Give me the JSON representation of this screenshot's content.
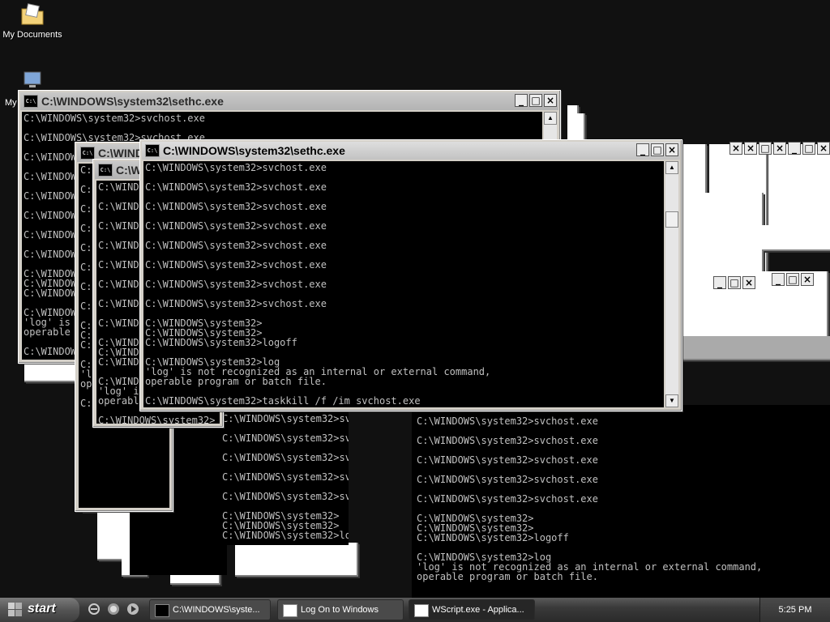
{
  "desktop": {
    "icons": [
      {
        "label": "My Documents",
        "icon": "folder-documents-icon"
      },
      {
        "label": "My",
        "icon": "my-computer-icon"
      }
    ]
  },
  "windows": {
    "back": {
      "title": "C:\\WINDOWS\\system32\\sethc.exe",
      "lines": [
        "C:\\WINDOWS\\system32>svchost.exe",
        "",
        "C:\\WINDOWS\\system32>svchost.exe",
        "",
        "C:\\WINDOWS\\system32>svchost.exe",
        "",
        "C:\\WINDOWS\\system32>svchost.exe",
        "",
        "C:\\WINDOWS\\system32>svchost.exe",
        "",
        "C:\\WINDOWS\\system32>svchost.exe",
        "",
        "C:\\WINDOWS\\system32>svchost.exe",
        "",
        "C:\\WINDOWS\\system32>svchost.exe",
        "",
        "C:\\WINDOWS\\system32>",
        "C:\\WINDOWS\\system32>",
        "C:\\WINDOWS\\system32>logoff",
        "",
        "C:\\WINDOWS\\system32>log",
        "'log' is not recognized as an internal or external command,",
        "operable program or batch file.",
        "",
        "C:\\WINDOWS\\system32>"
      ]
    },
    "middle": {
      "title": "C:\\WINDOWS\\system32\\sethc.exe",
      "lines": [
        "C:\\WINDOWS\\system32>svchost.exe",
        "",
        "C:\\WINDOWS\\system32>svchost.exe",
        "",
        "C:\\WINDOWS\\system32>svchost.exe",
        "",
        "C:\\WINDOWS\\system32>svchost.exe",
        "",
        "C:\\WINDOWS\\system32>svchost.exe",
        "",
        "C:\\WINDOWS\\system32>svchost.exe",
        "",
        "C:\\WINDOWS\\system32>svchost.exe",
        "",
        "C:\\WINDOWS\\system32>svchost.exe",
        "",
        "C:\\WINDOWS\\system32>",
        "C:\\WINDOWS\\system32>",
        "C:\\WINDOWS\\system32>logoff",
        "",
        "C:\\WINDOWS\\system32>log",
        "'log' is not recognized as an internal or external command,",
        "operable program or batch file.",
        "",
        "C:\\WINDOWS\\system32>"
      ]
    },
    "front": {
      "title": "C:\\WINDOWS\\system32\\sethc.exe",
      "lines": [
        "C:\\WINDOWS\\system32>svchost.exe",
        "",
        "C:\\WINDOWS\\system32>svchost.exe",
        "",
        "C:\\WINDOWS\\system32>svchost.exe",
        "",
        "C:\\WINDOWS\\system32>svchost.exe",
        "",
        "C:\\WINDOWS\\system32>svchost.exe",
        "",
        "C:\\WINDOWS\\system32>svchost.exe",
        "",
        "C:\\WINDOWS\\system32>svchost.exe",
        "",
        "C:\\WINDOWS\\system32>svchost.exe",
        "",
        "C:\\WINDOWS\\system32>",
        "C:\\WINDOWS\\system32>",
        "C:\\WINDOWS\\system32>logoff",
        "",
        "C:\\WINDOWS\\system32>log",
        "'log' is not recognized as an internal or external command,",
        "operable program or batch file.",
        "",
        "C:\\WINDOWS\\system32>taskkill /f /im svchost.exe"
      ]
    },
    "lower": {
      "lines": [
        "C:\\WINDOWS\\system32>svchost.exe",
        "",
        "C:\\WINDOWS\\system32>svchost.exe",
        "",
        "C:\\WINDOWS\\system32>svchost.exe",
        "",
        "C:\\WINDOWS\\system32>svchost.exe",
        "",
        "C:\\WINDOWS\\system32>svchost.exe",
        "",
        "C:\\WINDOWS\\system32>",
        "C:\\WINDOWS\\system32>",
        "C:\\WINDOWS\\system32>logoff",
        "",
        "C:\\WINDOWS\\system32>log",
        "'log' is not recognized as an internal or external command,",
        "operable program or batch file."
      ]
    },
    "window_buttons": {
      "minimize": "_",
      "maximize": "□",
      "close": "×"
    }
  },
  "taskbar": {
    "start_label": "start",
    "quick_launch": [
      "ie-icon",
      "firefox-icon",
      "media-player-icon"
    ],
    "buttons": [
      {
        "label": "C:\\WINDOWS\\syste...",
        "icon": "cmd-icon",
        "active": false
      },
      {
        "label": "Log On to Windows",
        "icon": "window-icon",
        "active": false
      },
      {
        "label": "WScript.exe - Applica...",
        "icon": "window-icon",
        "active": true
      }
    ],
    "clock": "5:25 PM"
  }
}
